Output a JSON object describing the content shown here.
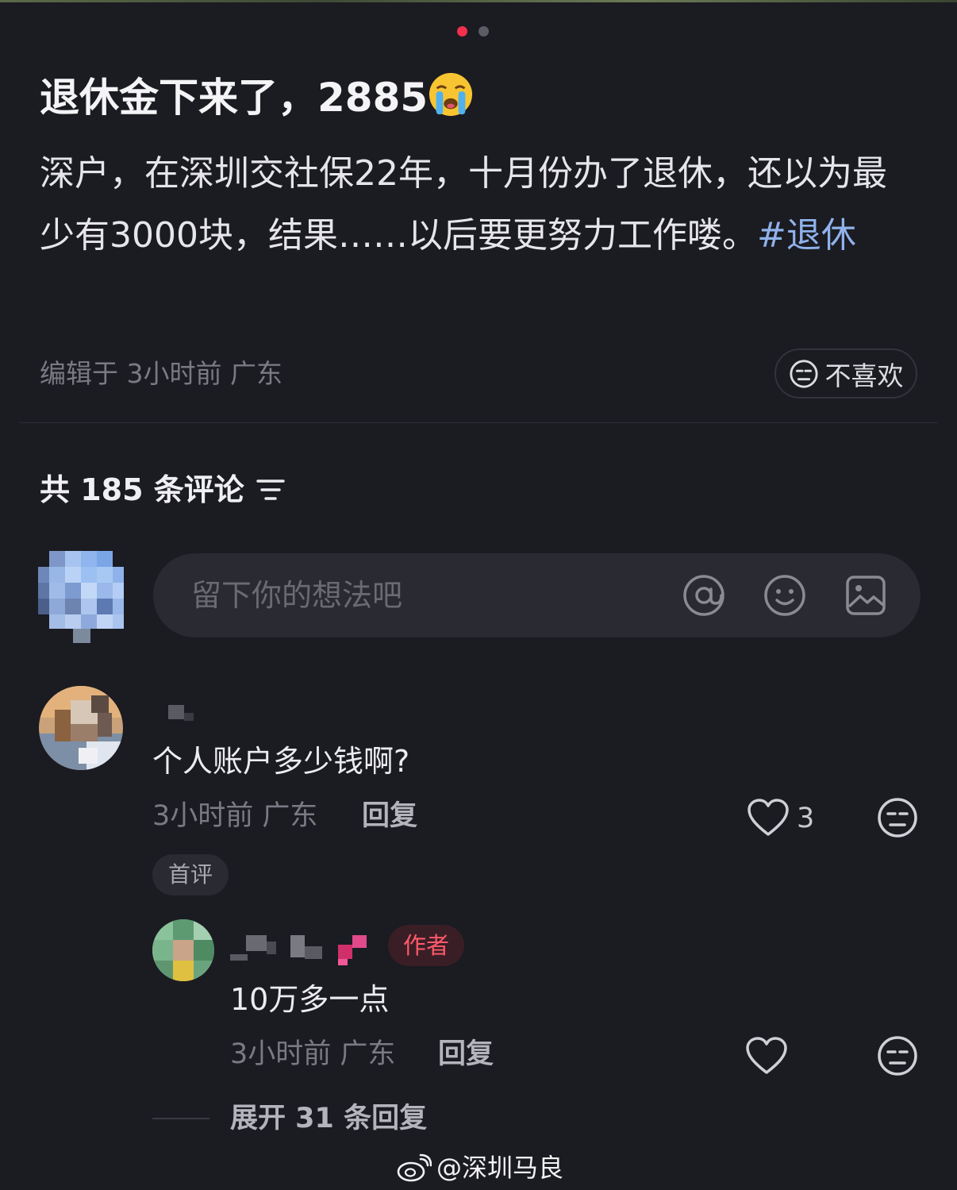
{
  "carousel": {
    "total": 2,
    "active_index": 0
  },
  "post": {
    "title": "退休金下来了，2885",
    "title_emoji": "crying-face",
    "body_text": "深户，在深圳交社保22年，十月份办了退休，还以为最少有3000块，结果……以后要更努力工作喽。",
    "hashtag": "#退休",
    "meta": "编辑于 3小时前 广东",
    "dislike_label": "不喜欢"
  },
  "comments_header": {
    "count_label": "共 185 条评论"
  },
  "composer": {
    "placeholder": "留下你的想法吧"
  },
  "comments": [
    {
      "text": "个人账户多少钱啊?",
      "meta": "3小时前 广东",
      "reply_label": "回复",
      "like_count": "3",
      "badge": "首评",
      "replies": [
        {
          "author_badge": "作者",
          "text": "10万多一点",
          "meta": "3小时前 广东",
          "reply_label": "回复"
        }
      ],
      "expand_label": "展开 31 条回复"
    }
  ],
  "watermark": "@深圳马良",
  "colors": {
    "background": "#1b1b22",
    "accent_red": "#f0304c",
    "hashtag_blue": "#8fb2ea",
    "muted_text": "#7a7a84"
  }
}
